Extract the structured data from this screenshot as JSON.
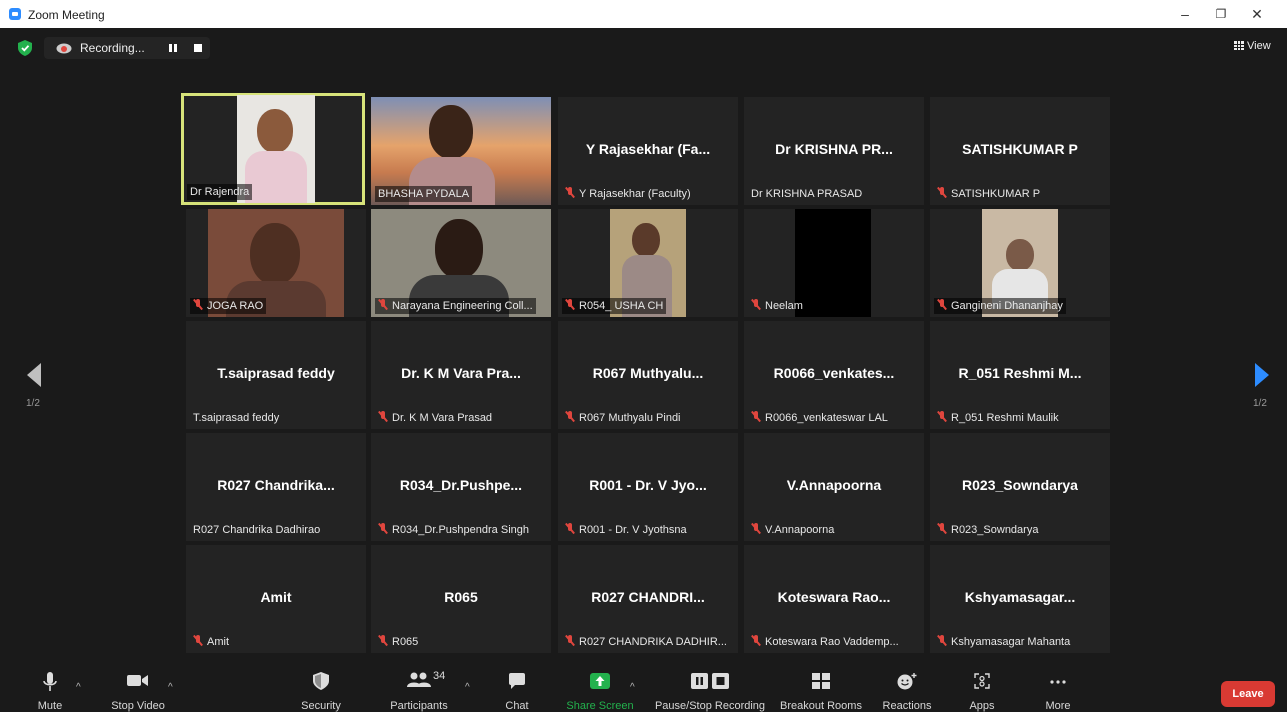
{
  "window": {
    "title": "Zoom Meeting",
    "minimize": "–",
    "restore": "❐",
    "close": "✕"
  },
  "topbar": {
    "recording_label": "Recording...",
    "view_label": "View"
  },
  "pager": {
    "left": "1/2",
    "right": "1/2"
  },
  "tiles": [
    {
      "big": "",
      "small": "Dr Rajendra",
      "muted": false
    },
    {
      "big": "",
      "small": "BHASHA PYDALA",
      "muted": false
    },
    {
      "big": "Y Rajasekhar (Fa...",
      "small": "Y Rajasekhar (Faculty)",
      "muted": true
    },
    {
      "big": "Dr KRISHNA PR...",
      "small": "Dr KRISHNA PRASAD",
      "muted": false
    },
    {
      "big": "SATISHKUMAR P",
      "small": "SATISHKUMAR P",
      "muted": true
    },
    {
      "big": "",
      "small": "JOGA RAO",
      "muted": true
    },
    {
      "big": "",
      "small": "Narayana Engineering Coll...",
      "muted": true
    },
    {
      "big": "",
      "small": "R054_ USHA CH",
      "muted": true
    },
    {
      "big": "",
      "small": "Neelam",
      "muted": true
    },
    {
      "big": "",
      "small": "Gangineni Dhananjhay",
      "muted": true
    },
    {
      "big": "T.saiprasad feddy",
      "small": "T.saiprasad feddy",
      "muted": false
    },
    {
      "big": "Dr. K M Vara Pra...",
      "small": "Dr. K M Vara Prasad",
      "muted": true
    },
    {
      "big": "R067 Muthyalu...",
      "small": "R067 Muthyalu Pindi",
      "muted": true
    },
    {
      "big": "R0066_venkates...",
      "small": "R0066_venkateswar LAL",
      "muted": true
    },
    {
      "big": "R_051 Reshmi M...",
      "small": "R_051 Reshmi Maulik",
      "muted": true
    },
    {
      "big": "R027 Chandrika...",
      "small": "R027 Chandrika Dadhirao",
      "muted": false
    },
    {
      "big": "R034_Dr.Pushpe...",
      "small": "R034_Dr.Pushpendra Singh",
      "muted": true
    },
    {
      "big": "R001 - Dr. V Jyo...",
      "small": "R001 - Dr. V Jyothsna",
      "muted": true
    },
    {
      "big": "V.Annapoorna",
      "small": "V.Annapoorna",
      "muted": true
    },
    {
      "big": "R023_Sowndarya",
      "small": "R023_Sowndarya",
      "muted": true
    },
    {
      "big": "Amit",
      "small": "Amit",
      "muted": true
    },
    {
      "big": "R065",
      "small": "R065",
      "muted": true
    },
    {
      "big": "R027 CHANDRI...",
      "small": "R027 CHANDRIKA DADHIR...",
      "muted": true
    },
    {
      "big": "Koteswara Rao...",
      "small": "Koteswara Rao Vaddemp...",
      "muted": true
    },
    {
      "big": "Kshyamasagar...",
      "small": "Kshyamasagar Mahanta",
      "muted": true
    }
  ],
  "toolbar": {
    "mute": "Mute",
    "stop_video": "Stop Video",
    "security": "Security",
    "participants": "Participants",
    "participant_count": "34",
    "chat": "Chat",
    "share_screen": "Share Screen",
    "pause_recording": "Pause/Stop Recording",
    "breakout": "Breakout Rooms",
    "reactions": "Reactions",
    "apps": "Apps",
    "more": "More",
    "leave": "Leave"
  },
  "colors": {
    "accent_active": "#d7e37a",
    "share_green": "#23b14d",
    "leave_red": "#d93a33",
    "muted_red": "#e0463e",
    "nav_blue": "#2d8cff"
  }
}
